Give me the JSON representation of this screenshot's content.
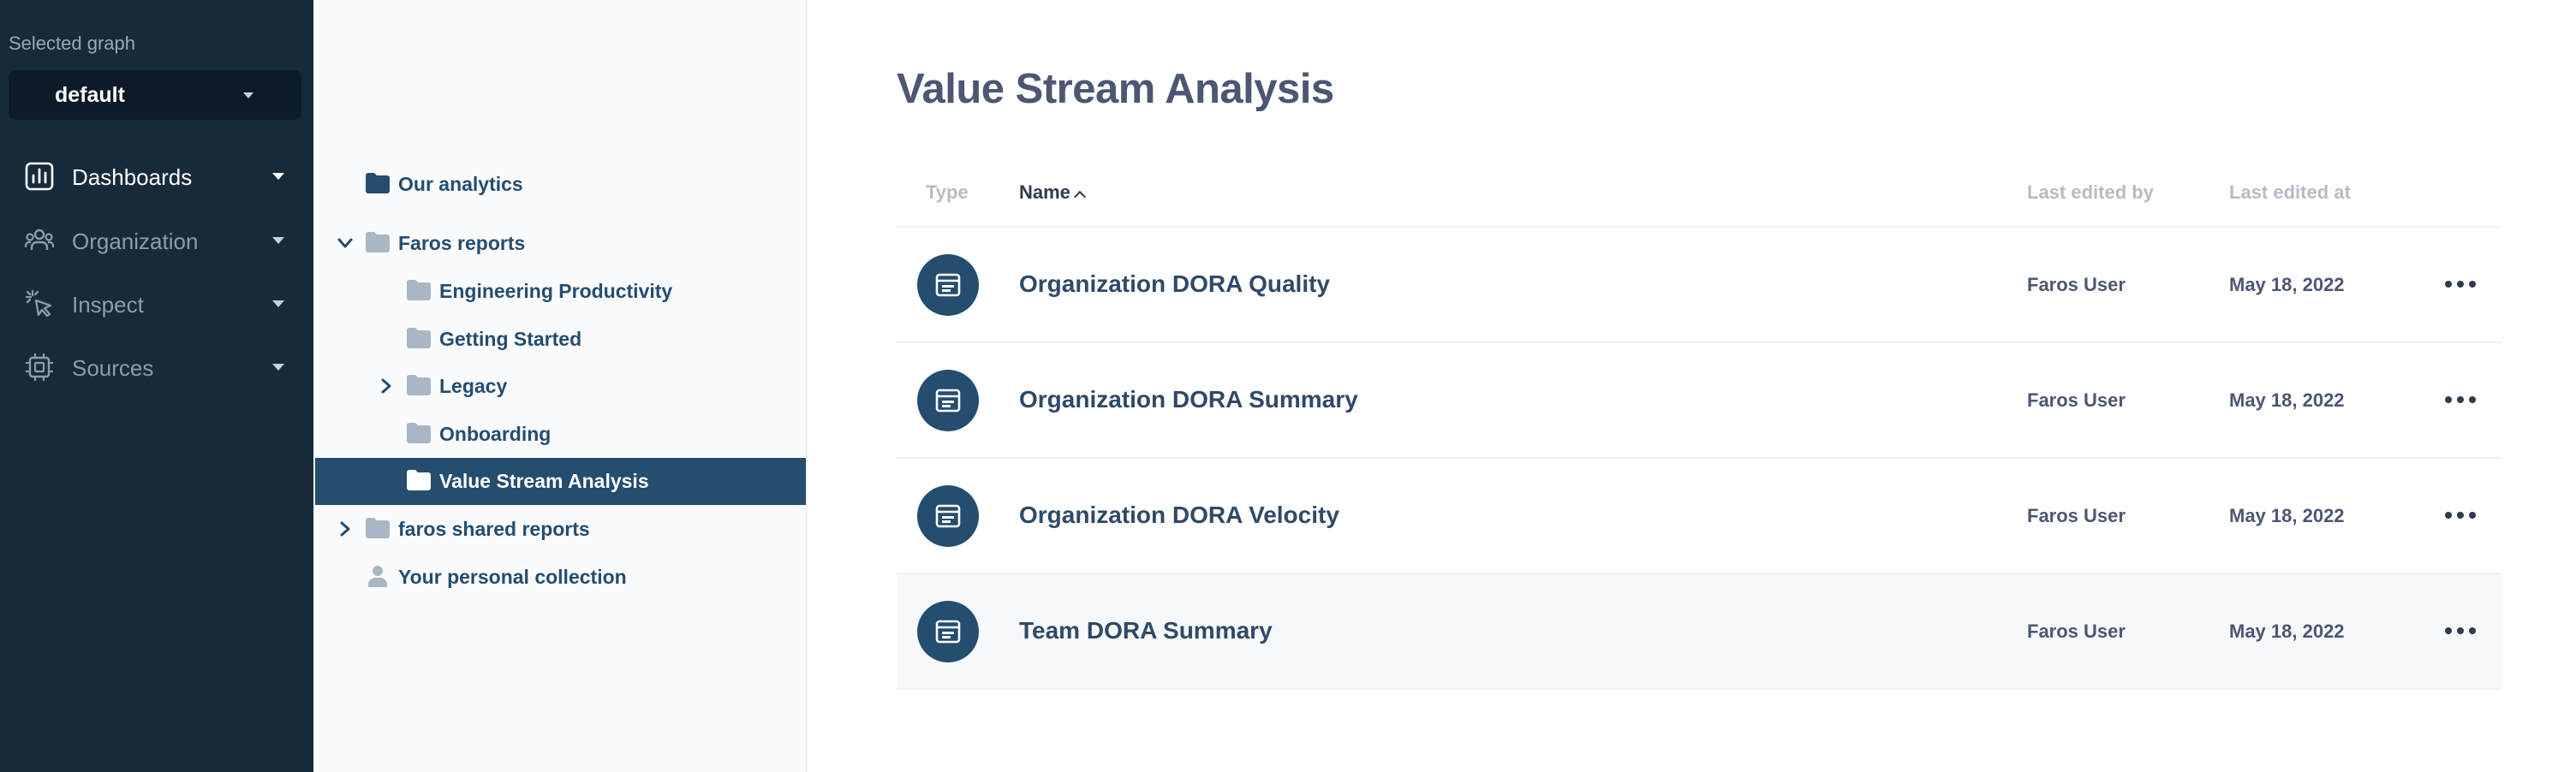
{
  "nav": {
    "selected_graph_label": "Selected graph",
    "graph_value": "default",
    "items": [
      {
        "label": "Dashboards",
        "icon": "bar-chart-icon",
        "active": true
      },
      {
        "label": "Organization",
        "icon": "people-icon",
        "active": false
      },
      {
        "label": "Inspect",
        "icon": "cursor-click-icon",
        "active": false
      },
      {
        "label": "Sources",
        "icon": "chip-icon",
        "active": false
      }
    ]
  },
  "tree": {
    "items": [
      {
        "label": "Our analytics",
        "icon": "folder-icon"
      },
      {
        "label": "Faros reports",
        "icon": "folder-icon",
        "expanded": true
      },
      {
        "label": "Engineering Productivity",
        "icon": "folder-icon"
      },
      {
        "label": "Getting Started",
        "icon": "folder-icon"
      },
      {
        "label": "Legacy",
        "icon": "folder-icon",
        "expanded": false
      },
      {
        "label": "Onboarding",
        "icon": "folder-icon"
      },
      {
        "label": "Value Stream Analysis",
        "icon": "folder-icon",
        "active": true
      },
      {
        "label": "faros shared reports",
        "icon": "folder-icon",
        "expanded": false
      },
      {
        "label": "Your personal collection",
        "icon": "person-icon"
      }
    ]
  },
  "main": {
    "title": "Value Stream Analysis",
    "columns": {
      "type": "Type",
      "name": "Name",
      "last_edited_by": "Last edited by",
      "last_edited_at": "Last edited at"
    },
    "rows": [
      {
        "name": "Organization DORA Quality",
        "editor": "Faros User",
        "date": "May 18, 2022"
      },
      {
        "name": "Organization DORA Summary",
        "editor": "Faros User",
        "date": "May 18, 2022"
      },
      {
        "name": "Organization DORA Velocity",
        "editor": "Faros User",
        "date": "May 18, 2022"
      },
      {
        "name": "Team DORA Summary",
        "editor": "Faros User",
        "date": "May 18, 2022"
      }
    ]
  },
  "colors": {
    "nav_bg": "#172a3a",
    "accent": "#244d6f",
    "title_text": "#4c5773"
  }
}
